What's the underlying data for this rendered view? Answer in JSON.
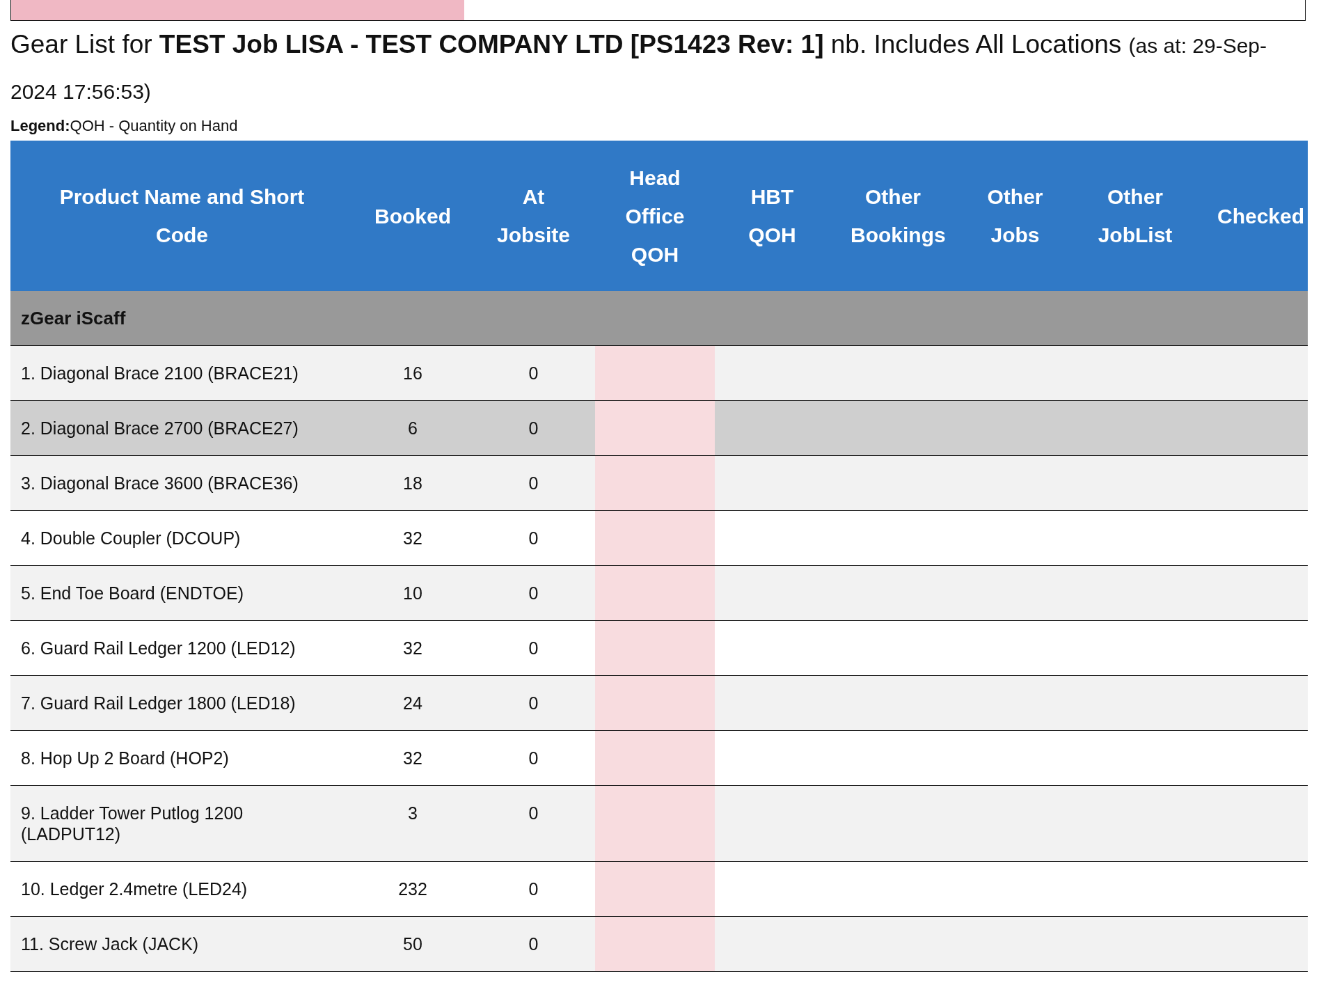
{
  "progress": {
    "level": 0.35
  },
  "heading": {
    "prefix": "Gear List for",
    "job": "TEST Job LISA - TEST COMPANY LTD [PS1423 Rev: 1]",
    "suffix": "nb. Includes All Locations",
    "as_at": "(as at: 29-Sep-2024 17:56:53)"
  },
  "legend": {
    "label": "Legend:",
    "text": "QOH - Quantity on Hand"
  },
  "table": {
    "columns": [
      "Product Name and Short Code",
      "Booked",
      "At Jobsite",
      "Head Office QOH",
      "HBT QOH",
      "Other Bookings",
      "Other Jobs",
      "Other JobList",
      "Checked"
    ],
    "groups": [
      {
        "name": "zGear iScaff",
        "rows": [
          {
            "name": "1. Diagonal Brace 2100 (BRACE21)",
            "booked": "16",
            "at_jobsite": "0",
            "head_office_short": true,
            "highlighted": false
          },
          {
            "name": "2. Diagonal Brace 2700 (BRACE27)",
            "booked": "6",
            "at_jobsite": "0",
            "head_office_short": true,
            "highlighted": true
          },
          {
            "name": "3. Diagonal Brace 3600 (BRACE36)",
            "booked": "18",
            "at_jobsite": "0",
            "head_office_short": true,
            "highlighted": false
          },
          {
            "name": "4. Double Coupler (DCOUP)",
            "booked": "32",
            "at_jobsite": "0",
            "head_office_short": true,
            "highlighted": false
          },
          {
            "name": "5. End Toe Board (ENDTOE)",
            "booked": "10",
            "at_jobsite": "0",
            "head_office_short": true,
            "highlighted": false
          },
          {
            "name": "6. Guard Rail Ledger 1200 (LED12)",
            "booked": "32",
            "at_jobsite": "0",
            "head_office_short": true,
            "highlighted": false
          },
          {
            "name": "7. Guard Rail Ledger 1800 (LED18)",
            "booked": "24",
            "at_jobsite": "0",
            "head_office_short": true,
            "highlighted": false
          },
          {
            "name": "8. Hop Up 2 Board (HOP2)",
            "booked": "32",
            "at_jobsite": "0",
            "head_office_short": true,
            "highlighted": false
          },
          {
            "name": "9. Ladder Tower Putlog 1200 (LADPUT12)",
            "booked": "3",
            "at_jobsite": "0",
            "head_office_short": true,
            "highlighted": false
          },
          {
            "name": "10. Ledger 2.4metre (LED24)",
            "booked": "232",
            "at_jobsite": "0",
            "head_office_short": true,
            "highlighted": false
          },
          {
            "name": "11. Screw Jack (JACK)",
            "booked": "50",
            "at_jobsite": "0",
            "head_office_short": true,
            "highlighted": false
          }
        ]
      }
    ]
  }
}
